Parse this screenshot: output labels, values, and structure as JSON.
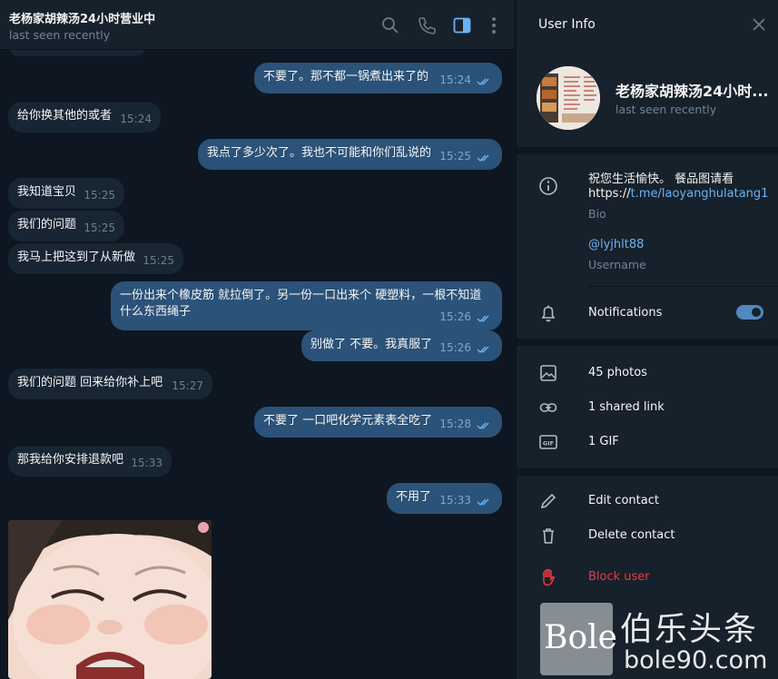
{
  "chat": {
    "title": "老杨家胡辣汤24小时营业中",
    "status": "last seen recently",
    "messages": [
      {
        "dir": "out",
        "text": "不要了。那不都一锅煮出来了的",
        "time": "15:24"
      },
      {
        "dir": "in",
        "text": "给你换其他的或者",
        "time": "15:24"
      },
      {
        "dir": "out",
        "text": "我点了多少次了。我也不可能和你们乱说的",
        "time": "15:25"
      },
      {
        "dir": "in",
        "text": "我知道宝贝",
        "time": "15:25"
      },
      {
        "dir": "in",
        "text": "我们的问题",
        "time": "15:25"
      },
      {
        "dir": "in",
        "text": "我马上把这到了从新做",
        "time": "15:25"
      },
      {
        "dir": "out",
        "text": "一份出来个橡皮筋 就拉倒了。另一份一口出来个 硬塑料，一根不知道\n什么东西绳子",
        "time": "15:26"
      },
      {
        "dir": "out",
        "text": "别做了 不要。我真服了",
        "time": "15:26"
      },
      {
        "dir": "in",
        "text": "我们的问题 回来给你补上吧",
        "time": "15:27"
      },
      {
        "dir": "out",
        "text": "不要了 一口吧化学元素表全吃了",
        "time": "15:28"
      },
      {
        "dir": "in",
        "text": "那我给你安排退款吧",
        "time": "15:33"
      },
      {
        "dir": "out",
        "text": "不用了",
        "time": "15:33"
      }
    ]
  },
  "info": {
    "title": "User Info",
    "name": "老杨家胡辣汤24小时...",
    "status": "last seen recently",
    "bio_line1": "祝您生活愉快。 餐品图请看",
    "bio_link_prefix": "https://",
    "bio_link": "t.me/laoyanghulatang1",
    "bio_label": "Bio",
    "username": "@lyjhlt88",
    "username_label": "Username",
    "notifications": "Notifications",
    "notifications_on": true,
    "photos": "45 photos",
    "links": "1 shared link",
    "gifs": "1 GIF",
    "edit": "Edit contact",
    "delete": "Delete contact",
    "block": "Block user"
  },
  "watermark": {
    "logo": "Bole",
    "cn": "伯乐头条",
    "url": "bole90.com"
  },
  "colors": {
    "bg": "#0e1621",
    "panel": "#17212b",
    "bubble_in": "#182533",
    "bubble_out": "#2b5278",
    "accent": "#6ab3f3",
    "danger": "#ec3942"
  }
}
